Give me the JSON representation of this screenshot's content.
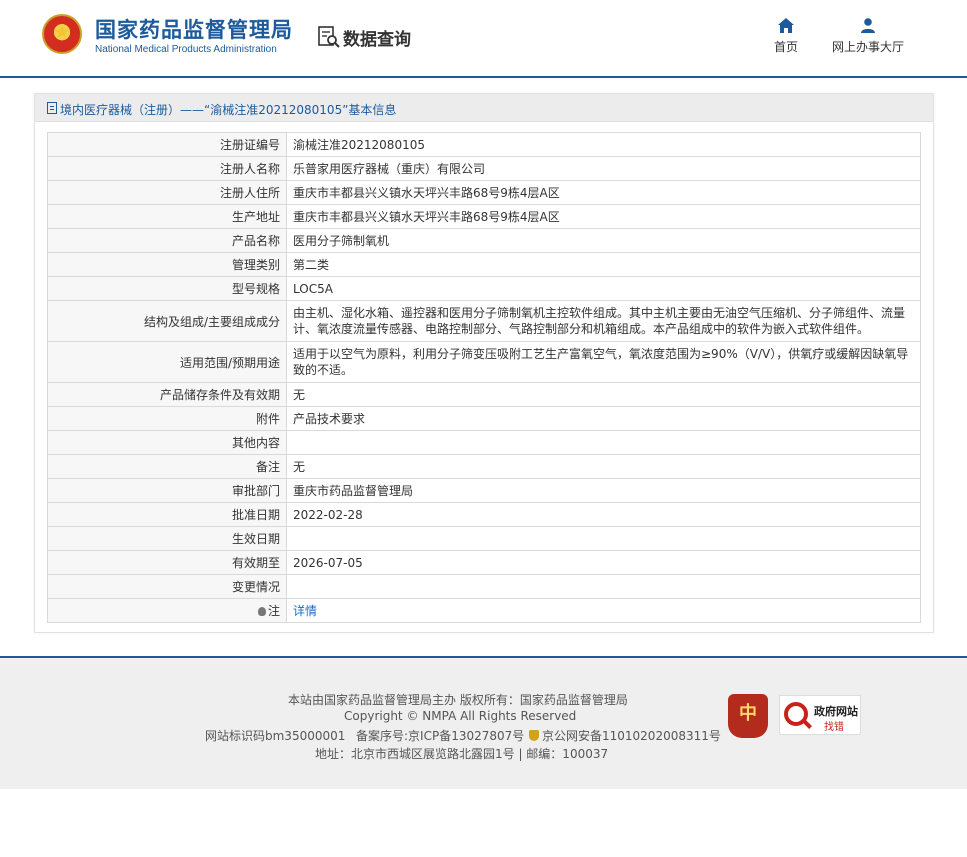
{
  "header": {
    "site_title_cn": "国家药品监督管理局",
    "site_title_en": "National Medical Products Administration",
    "section_title": "数据查询",
    "nav": [
      {
        "label": "首页",
        "icon": "home-icon"
      },
      {
        "label": "网上办事大厅",
        "icon": "user-icon"
      }
    ]
  },
  "breadcrumb": "境内医疗器械（注册）——“渝械注准20212080105”基本信息",
  "fields": [
    {
      "key": "注册证编号",
      "value": "渝械注准20212080105"
    },
    {
      "key": "注册人名称",
      "value": "乐普家用医疗器械（重庆）有限公司"
    },
    {
      "key": "注册人住所",
      "value": "重庆市丰都县兴义镇水天坪兴丰路68号9栋4层A区"
    },
    {
      "key": "生产地址",
      "value": "重庆市丰都县兴义镇水天坪兴丰路68号9栋4层A区"
    },
    {
      "key": "产品名称",
      "value": "医用分子筛制氧机"
    },
    {
      "key": "管理类别",
      "value": "第二类"
    },
    {
      "key": "型号规格",
      "value": "LOC5A"
    },
    {
      "key": "结构及组成/主要组成成分",
      "value": "由主机、湿化水箱、遥控器和医用分子筛制氧机主控软件组成。其中主机主要由无油空气压缩机、分子筛组件、流量计、氧浓度流量传感器、电路控制部分、气路控制部分和机箱组成。本产品组成中的软件为嵌入式软件组件。"
    },
    {
      "key": "适用范围/预期用途",
      "value": "适用于以空气为原料，利用分子筛变压吸附工艺生产富氧空气，氧浓度范围为≥90%（V/V），供氧疗或缓解因缺氧导致的不适。"
    },
    {
      "key": "产品储存条件及有效期",
      "value": "无"
    },
    {
      "key": "附件",
      "value": "产品技术要求"
    },
    {
      "key": "其他内容",
      "value": ""
    },
    {
      "key": "备注",
      "value": "无"
    },
    {
      "key": "审批部门",
      "value": "重庆市药品监督管理局"
    },
    {
      "key": "批准日期",
      "value": "2022-02-28"
    },
    {
      "key": "生效日期",
      "value": ""
    },
    {
      "key": "有效期至",
      "value": "2026-07-05"
    },
    {
      "key": "变更情况",
      "value": ""
    }
  ],
  "note": {
    "key": "注",
    "value": "详情"
  },
  "footer": {
    "line1": "本站由国家药品监督管理局主办 版权所有：国家药品监督管理局",
    "line2": "Copyright © NMPA All Rights Reserved",
    "line3a": "网站标识码bm35000001",
    "line3b": "备案序号:京ICP备13027807号",
    "line3c": "京公网安备11010202008311号",
    "line4": "地址：北京市西城区展览路北露园1号 | 邮编：100037",
    "party_badge_text": "中",
    "gov_badge_t1": "政府网站",
    "gov_badge_t2": "找错"
  }
}
